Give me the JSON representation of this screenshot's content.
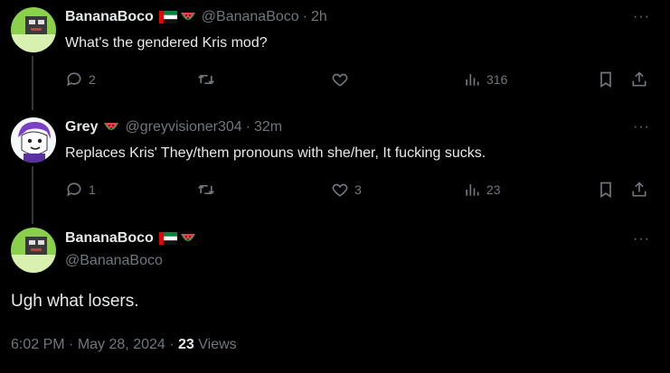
{
  "tweets": [
    {
      "name": "BananaBoco",
      "handle": "@BananaBoco",
      "time": "2h",
      "text": "What's the gendered Kris mod?",
      "replies": "2",
      "retweets": "",
      "likes": "",
      "views": "316"
    },
    {
      "name": "Grey",
      "handle": "@greyvisioner304",
      "time": "32m",
      "text": "Replaces Kris' They/them pronouns with she/her, It fucking sucks.",
      "replies": "1",
      "retweets": "",
      "likes": "3",
      "views": "23"
    }
  ],
  "main": {
    "name": "BananaBoco",
    "handle": "@BananaBoco",
    "text": "Ugh what losers.",
    "time": "6:02 PM",
    "date": "May 28, 2024",
    "views_count": "23",
    "views_label": "Views"
  },
  "separator": "·",
  "more_label": "···",
  "colors": {
    "bg": "#000000",
    "text": "#e7e9ea",
    "muted": "#71767b",
    "line": "#333639"
  }
}
